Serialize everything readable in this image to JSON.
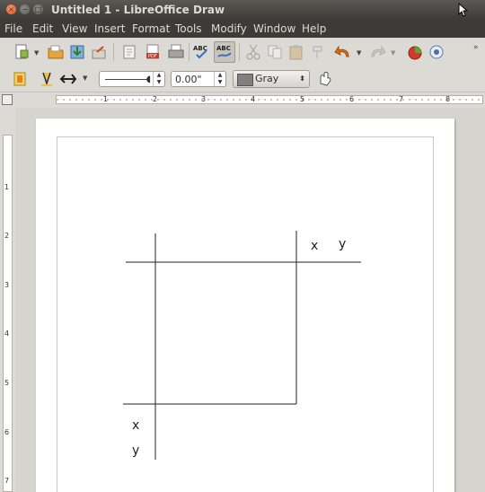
{
  "window": {
    "title": "Untitled 1 - LibreOffice Draw"
  },
  "menu": [
    "File",
    "Edit",
    "View",
    "Insert",
    "Format",
    "Tools",
    "Modify",
    "Window",
    "Help"
  ],
  "toolbar2": {
    "line_width": "0.00\"",
    "fill_color": "Gray"
  },
  "ruler": {
    "horizontal": [
      "1",
      "2",
      "3",
      "4",
      "5",
      "6",
      "7",
      "8"
    ],
    "vertical": [
      "1",
      "2",
      "3",
      "4",
      "5",
      "6",
      "7"
    ]
  },
  "drawing": {
    "top_right_x": "x",
    "top_right_y": "y",
    "bottom_left_x": "x",
    "bottom_left_y": "y"
  }
}
